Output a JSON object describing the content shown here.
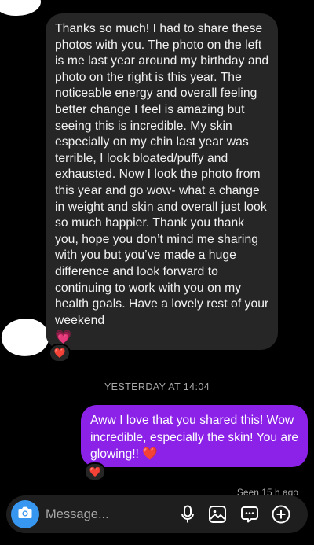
{
  "thread": {
    "incoming": {
      "text": "Thanks so much! I had to share these photos with you. The photo on the left is me last year around my birthday and photo on the right is this year. The noticeable energy and overall feeling better change I feel is amazing but seeing this is incredible. My skin especially on my chin last year was terrible, I look bloated/puffy and exhausted. Now I look the photo from this year and go wow- what a change in weight and skin and overall just look so much happier. Thank you thank you, hope you don’t mind me sharing with you but you’ve made a huge difference and look forward to continuing to work with you on my health goals. Have a lovely rest of your weekend",
      "emoji": "💗",
      "reaction": "❤️"
    },
    "timestamp": "YESTERDAY AT 14:04",
    "outgoing": {
      "text": "Aww I love that you shared this! Wow incredible, especially the skin! You are glowing!!",
      "emoji": "❤️",
      "reaction": "❤️"
    },
    "seen": "Seen 15 h ago"
  },
  "composer": {
    "placeholder": "Message...",
    "icons": [
      "camera-icon",
      "microphone-icon",
      "gallery-icon",
      "sticker-icon",
      "plus-icon"
    ]
  },
  "colors": {
    "background": "#000000",
    "incoming_bubble": "#262626",
    "outgoing_bubble": "#8c22e8",
    "camera_button": "#3797f0"
  }
}
